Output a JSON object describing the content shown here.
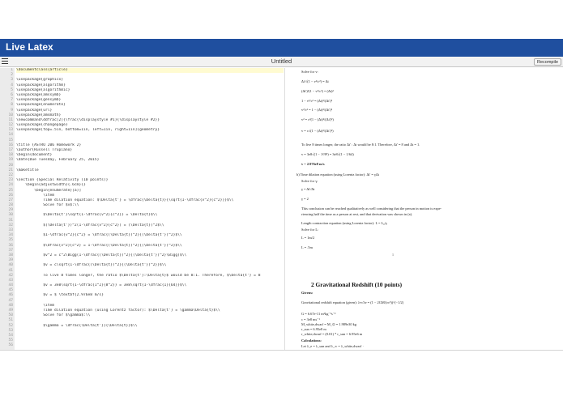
{
  "app": {
    "title": "Live Latex"
  },
  "toolbar": {
    "document_title": "Untitled",
    "recompile_label": "Recompile"
  },
  "editor": {
    "line_numbers": [
      "1",
      "2",
      "3",
      "4",
      "5",
      "6",
      "7",
      "8",
      "9",
      "10",
      "11",
      "12",
      "13",
      "14",
      "15",
      "16",
      "17",
      "18",
      "19",
      "20",
      "21",
      "22",
      "23",
      "24",
      "25",
      "26",
      "27",
      "28",
      "29",
      "30",
      "31",
      "32",
      "33",
      "34",
      "35",
      "36",
      "37",
      "38",
      "39",
      "40",
      "41",
      "42",
      "43",
      "44",
      "45",
      "46",
      "47",
      "48",
      "49",
      "50",
      "51",
      "52",
      "53",
      "54",
      "55",
      "56"
    ],
    "lines": [
      "\\documentclass{article}",
      "",
      "\\usepackage{graphicx}",
      "\\usepackage{algorithm}",
      "\\usepackage{algorithmic}",
      "\\usepackage{amssymb}",
      "\\usepackage{gensymb}",
      "\\usepackage{enumerate}",
      "\\usepackage{url}",
      "\\usepackage{amsmath}",
      "\\newcommand\\ddfrac[2]{\\frac{\\displaystyle #1}{\\displaystyle #2}}",
      "\\usepackage{changepage}",
      "\\usepackage[top=.5in, bottom=1in, left=1in, right=1in]{geometry}",
      "",
      "",
      "\\title {ASTRO 206 Homework 2}",
      "\\author{Russell Trupiano}",
      "\\begin{document}",
      "\\date{Due Tuesday, February 25, 2015}",
      "",
      "\\maketitle",
      "",
      "\\section {Special Relativity (10 points)}",
      "    \\begin{adjustwidth}{.6cm}{}",
      "        \\begin{enumerate}[a)]",
      "            \\item",
      "            Time dilation equation: $\\Delta{t'} = \\dfrac{\\Delta{t}}{\\sqrt{1-\\dfrac{v^2}{c^2}}}$\\\\",
      "            Solve for $v$:\\\\",
      "",
      "            $\\Delta{t'}\\sqrt{1-\\dfrac{v^2}{c^2}} = \\Delta{t}$\\\\",
      "",
      "            $(\\Delta{t'})^2(1-\\dfrac{v^2}{c^2}) = (\\Delta{t})^2$\\\\",
      "",
      "            $1-\\dfrac{v^2}{c^2} = \\dfrac{(\\Delta{t})^2}{(\\Delta{t'})^2}$\\\\",
      "",
      "            $\\dfrac{v^2}{c^2} = 1-\\dfrac{(\\Delta{t})^2}{(\\Delta{t'})^2}$\\\\",
      "",
      "            $v^2 = c^2\\Bigg(1-\\dfrac{(\\Delta{t})^2}{(\\Delta{t'})^2}\\Bigg)$\\\\",
      "",
      "            $v = c\\sqrt{1-\\dfrac{(\\Delta{t})^2}{(\\Delta{t'})^2}}$\\\\",
      "",
      "            To live 8 times longer, the ratio $\\Delta{t'}:\\Delta{t}$ would be 8:1. Therefore, $\\Delta{t'} = 8",
      "",
      "            $v = 3e8\\sqrt{1-\\dfrac{1^2}{8^2}} = 3e8\\sqrt{1-\\dfrac{1}{64}}$\\\\",
      "",
      "            $v = $ \\textbf{2.976e8 m/s}",
      "",
      "            \\item",
      "            Time dilation equation (using Lorentz factor): $\\Delta{t'} = \\gamma\\Delta{t}$\\\\",
      "            Solve for $\\gamma$:\\\\",
      "",
      "            $\\gamma = \\dfrac{\\Delta{t'}}{\\Delta{t}}$\\\\",
      "",
      "",
      "",
      ""
    ]
  },
  "preview": {
    "lines": [
      "Solve for v:",
      "Δt'√(1 − v²/c²) = Δt",
      "(Δt')²(1 − v²/c²) = (Δt)²",
      "1 − v²/c² = (Δt)²/(Δt')²",
      "v²/c² = 1 − (Δt)²/(Δt')²",
      "v² = c²(1 − (Δt)²/(Δt')²)",
      "v = c√(1 − (Δt)²/(Δt')²)",
      "To live 8 times longer, the ratio Δt' : Δt would be 8:1. Therefore, Δt' = 8 and Δt = 1.",
      "v = 3e8√(1 − 1²/8²) = 3e8√(1 − 1/64)",
      "v = 2.976e8 m/s",
      "b) Time dilation equation (using Lorentz factor): Δt' = γΔt",
      "Solve for γ:",
      "γ = Δt'/Δt",
      "γ = 2",
      "This conclusion can be reached qualitatively as well considering that the person in motion is expe-",
      "riencing half the time as a person at rest, and that derivation was shown in (a).",
      "Length contraction equation (using Lorentz factor): L = L₀/γ",
      "Solve for L:",
      "L = 1m/2",
      "L = .5m",
      "1"
    ],
    "section_title": "2   Gravitational Redshift (10 points)",
    "after_section": [
      "Givens:",
      "Gravitational redshift equation (given): λ∞/λe = (1 − 2GM/(rc²))^(−1/2)",
      "G = 6.67e-11 m³kg⁻¹s⁻²",
      "c = 3e8 ms⁻¹",
      "M_white,dwarf = M_⊙ = 1.989e30 kg",
      "r_sun = 6.95e8 m",
      "r_white,dwarf = (0.01) * r_sun = 6.95e6 m",
      "Calculations:",
      "Let λ_e = λ_sun and λ_∞ = λ_white,dwarf ·"
    ]
  }
}
